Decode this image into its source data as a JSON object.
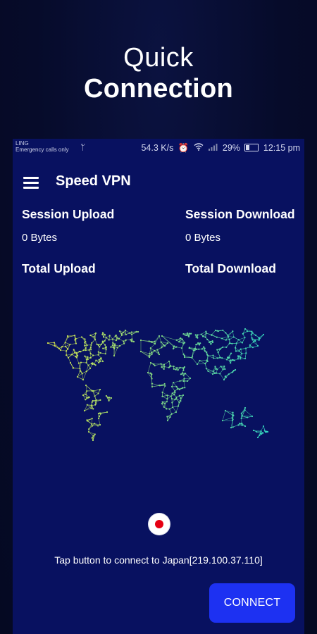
{
  "promo": {
    "line1": "Quick",
    "line2": "Connection"
  },
  "status_bar": {
    "network": "LING",
    "carrier_note": "Emergency calls only",
    "speed": "54.3 K/s",
    "battery": "29%",
    "time": "12:15 pm",
    "icons": [
      "usb-icon",
      "alarm-icon",
      "wifi-icon",
      "signal-icon",
      "battery-icon"
    ]
  },
  "app_bar": {
    "title": "Speed VPN",
    "menu_icon": "hamburger-menu-icon"
  },
  "stats": {
    "session_upload_label": "Session Upload",
    "session_upload_value": "0 Bytes",
    "session_download_label": "Session Download",
    "session_download_value": "0 Bytes",
    "total_upload_label": "Total Upload",
    "total_download_label": "Total Download"
  },
  "map": {
    "icon": "world-network-map",
    "colors": [
      "#d8e34a",
      "#5fe0a8",
      "#2fd6c4"
    ]
  },
  "server": {
    "flag": "japan-flag-icon",
    "flag_color": "#e60012"
  },
  "hint_text": "Tap button to connect to Japan[219.100.37.110]",
  "connect_button": {
    "label": "CONNECT",
    "color": "#1d31f2"
  },
  "theme": {
    "background": "#081160",
    "outer_background": "#060b2a"
  }
}
